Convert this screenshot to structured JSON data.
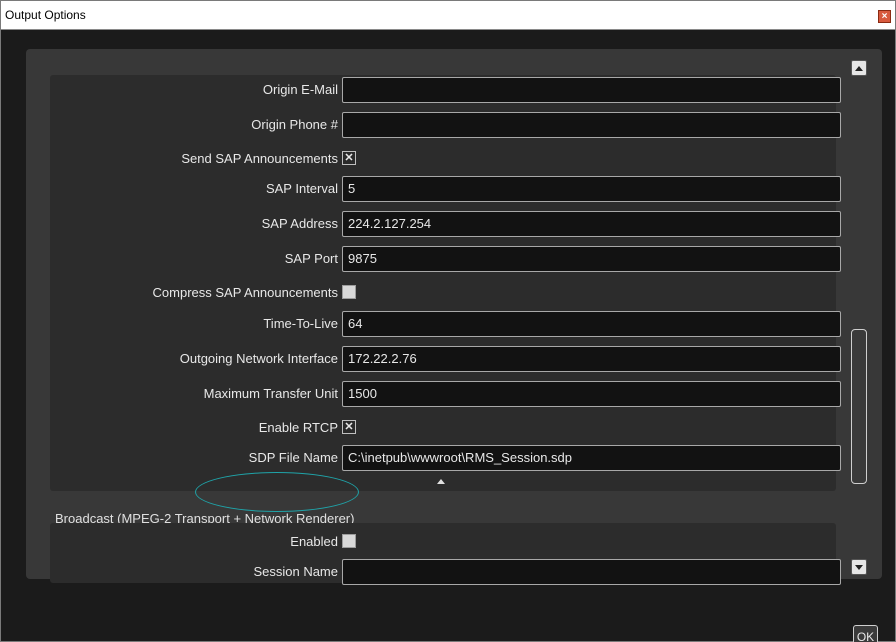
{
  "window": {
    "title": "Output Options",
    "close_glyph": "×"
  },
  "settings": {
    "origin_email": {
      "label": "Origin E-Mail",
      "value": ""
    },
    "origin_phone": {
      "label": "Origin Phone #",
      "value": ""
    },
    "send_sap": {
      "label": "Send SAP Announcements",
      "checked": true,
      "glyph": "✕"
    },
    "sap_interval": {
      "label": "SAP Interval",
      "value": "5"
    },
    "sap_address": {
      "label": "SAP Address",
      "value": "224.2.127.254"
    },
    "sap_port": {
      "label": "SAP Port",
      "value": "9875"
    },
    "compress_sap": {
      "label": "Compress SAP Announcements",
      "checked": false,
      "glyph": ""
    },
    "ttl": {
      "label": "Time-To-Live",
      "value": "64"
    },
    "network_interface": {
      "label": "Outgoing Network Interface",
      "value": "172.22.2.76"
    },
    "mtu": {
      "label": "Maximum Transfer Unit",
      "value": "1500"
    },
    "enable_rtcp": {
      "label": "Enable RTCP",
      "checked": true,
      "glyph": "✕"
    },
    "sdp_file": {
      "label": "SDP File Name",
      "value": "C:\\inetpub\\wwwroot\\RMS_Session.sdp"
    }
  },
  "broadcast": {
    "header": "Broadcast (MPEG-2 Transport + Network Renderer)",
    "enabled": {
      "label": "Enabled",
      "checked": false,
      "glyph": ""
    },
    "session_name": {
      "label": "Session Name",
      "value": ""
    }
  },
  "buttons": {
    "ok_label": "OK"
  },
  "icons": {
    "close": "close-icon",
    "scroll_up": "scroll-up-icon",
    "scroll_down": "scroll-down-icon",
    "collapse": "collapse-arrow-icon"
  },
  "colors": {
    "background": "#1b1b1b",
    "panel": "#383838",
    "group": "#2c2c2c",
    "field": "#121212",
    "highlight": "#1fa3a8"
  }
}
